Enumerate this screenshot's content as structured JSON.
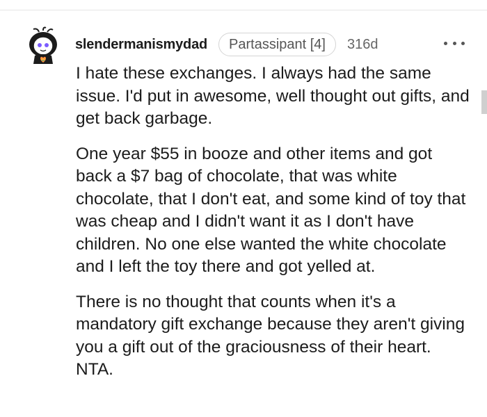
{
  "comment": {
    "username": "slendermanismydad",
    "flair": "Partassipant [4]",
    "age": "316d",
    "paragraphs": [
      "I hate these exchanges. I always had the same issue. I'd put in awesome, well thought out gifts, and get back garbage.",
      "One year $55 in booze and other items and got back a $7 bag of chocolate, that was white chocolate, that I don't eat, and some kind of toy that was cheap and I didn't want it as I don't have children. No one else wanted the white chocolate and I left the toy there and got yelled at.",
      "There is no thought that counts when it's a mandatory gift exchange because they aren't giving you a gift out of the graciousness of their heart. NTA."
    ]
  },
  "icons": {
    "avatar": "snoo-avatar-icon",
    "more": "more-options-icon"
  }
}
